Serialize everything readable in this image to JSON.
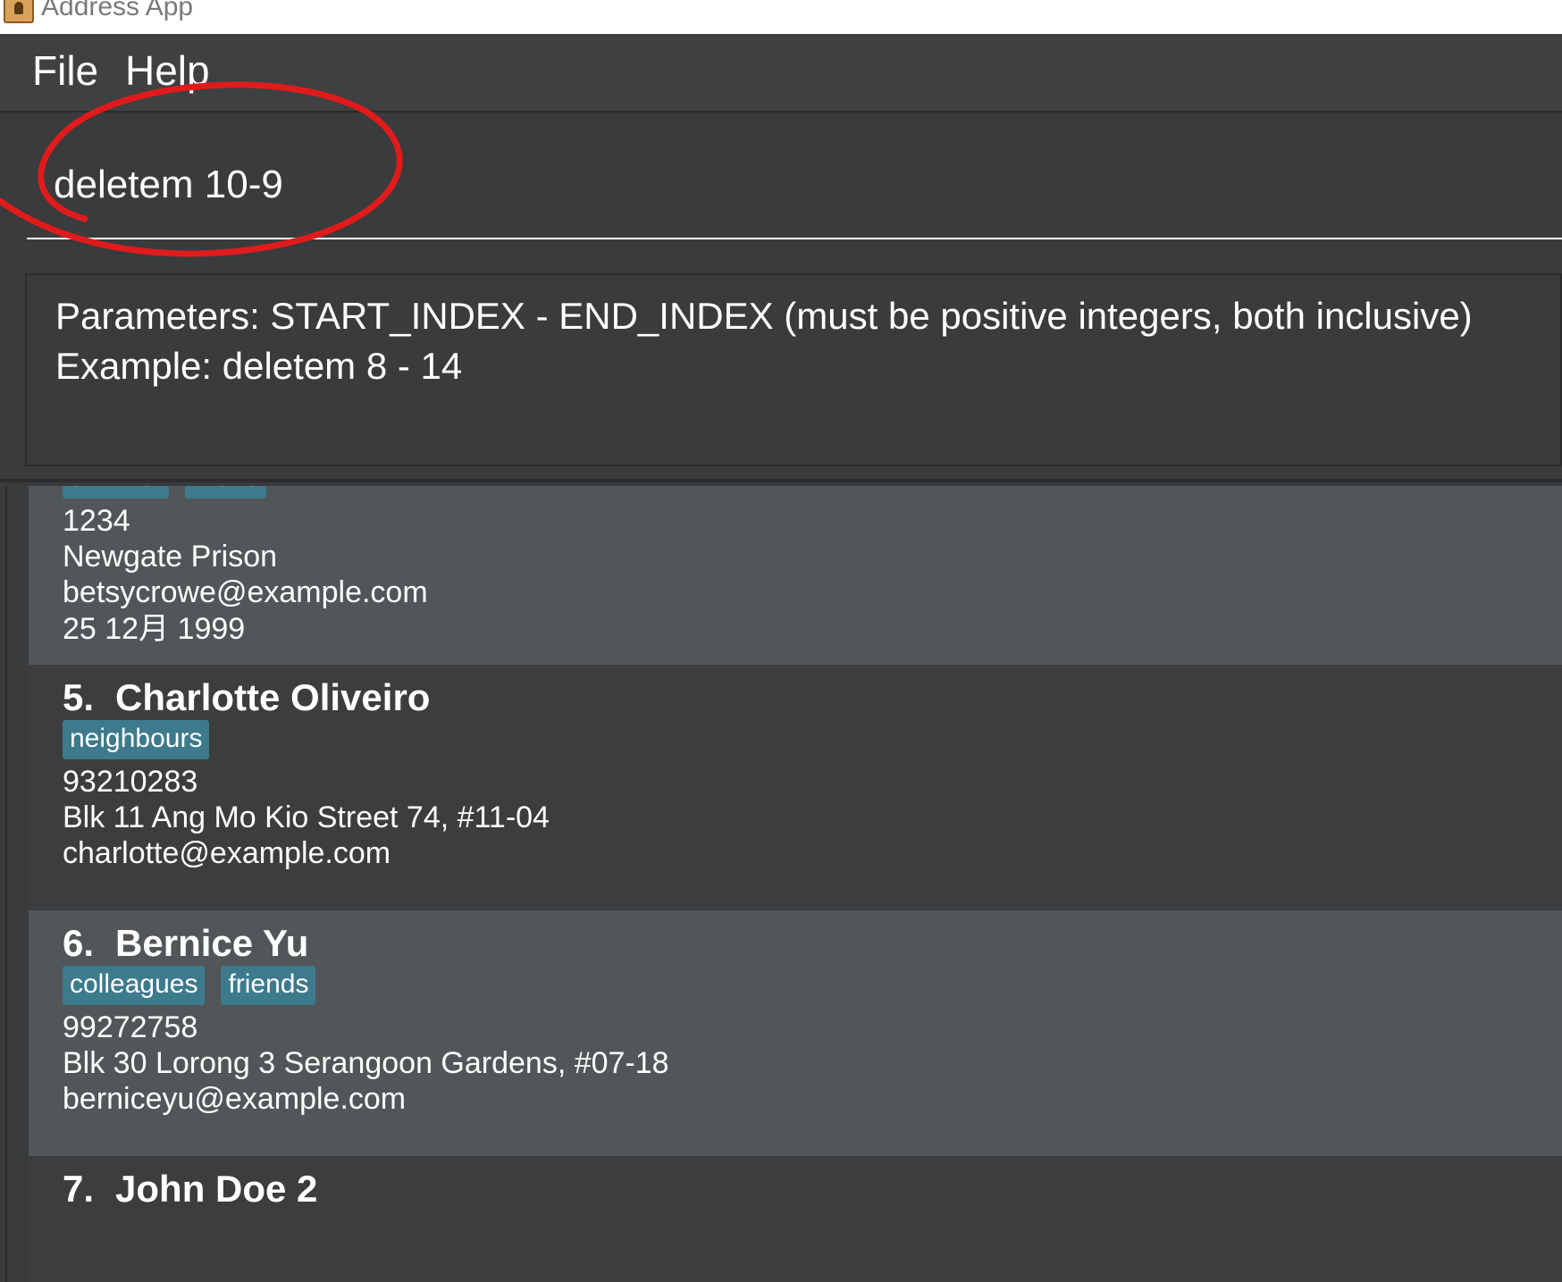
{
  "window": {
    "title": "Address App"
  },
  "menu": {
    "file": "File",
    "help": "Help"
  },
  "command": {
    "value": "deletem 10-9"
  },
  "result": {
    "line1": "Parameters: START_INDEX - END_INDEX (must be positive integers, both inclusive)",
    "line2": "Example: deletem 8 - 14"
  },
  "persons": [
    {
      "index": "",
      "name": "",
      "tags": [
        "criminal",
        "friend"
      ],
      "phone": "1234",
      "address": "Newgate Prison",
      "email": "betsycrowe@example.com",
      "date": "25 12月 1999"
    },
    {
      "index": "5.",
      "name": "Charlotte Oliveiro",
      "tags": [
        "neighbours"
      ],
      "phone": "93210283",
      "address": "Blk 11 Ang Mo Kio Street 74, #11-04",
      "email": "charlotte@example.com"
    },
    {
      "index": "6.",
      "name": "Bernice Yu",
      "tags": [
        "colleagues",
        "friends"
      ],
      "phone": "99272758",
      "address": "Blk 30 Lorong 3 Serangoon Gardens, #07-18",
      "email": "berniceyu@example.com"
    },
    {
      "index": "7.",
      "name": "John Doe 2"
    }
  ],
  "colors": {
    "background": "#3a3b3d",
    "card_light": "#515658",
    "card_dark": "#3c3d3f",
    "tag": "#3d7a8c",
    "annotation": "#e01b1b"
  },
  "icons": {
    "app": "address-book-icon"
  }
}
